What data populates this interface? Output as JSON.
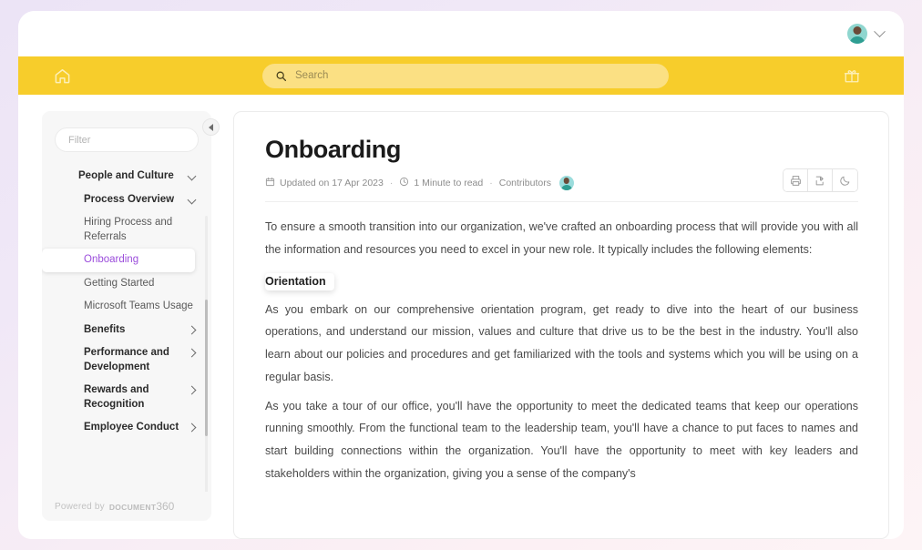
{
  "account": {
    "avatar_name": "user-avatar",
    "chevron": "chevron-down-icon"
  },
  "navbar": {
    "home_icon": "home-icon",
    "gift_icon": "gift-icon",
    "search": {
      "icon": "search-icon",
      "placeholder": "Search",
      "value": ""
    },
    "background_color": "#f7cd2b",
    "search_background_color": "#fbe083"
  },
  "sidebar": {
    "collapse_icon": "collapse-left-icon",
    "filter": {
      "placeholder": "Filter",
      "value": ""
    },
    "items": [
      {
        "label": "People and Culture",
        "level": 1,
        "chevron": "down",
        "selected": false
      },
      {
        "label": "Process Overview",
        "level": 2,
        "chevron": "down",
        "selected": false
      },
      {
        "label": "Hiring Process and Referrals",
        "level": 3,
        "chevron": "",
        "selected": false
      },
      {
        "label": "Onboarding",
        "level": 3,
        "chevron": "",
        "selected": true
      },
      {
        "label": "Getting Started",
        "level": 3,
        "chevron": "",
        "selected": false
      },
      {
        "label": "Microsoft Teams Usage",
        "level": 3,
        "chevron": "",
        "selected": false
      },
      {
        "label": "Benefits",
        "level": 2,
        "chevron": "right",
        "selected": false
      },
      {
        "label": "Performance and Development",
        "level": 2,
        "chevron": "right",
        "selected": false
      },
      {
        "label": "Rewards and Recognition",
        "level": 2,
        "chevron": "right",
        "selected": false
      },
      {
        "label": "Employee Conduct",
        "level": 2,
        "chevron": "right",
        "selected": false
      }
    ],
    "selected_color": "#9b4ddb",
    "footer": {
      "powered_by": "Powered by",
      "brand_prefix": "DOCUMENT",
      "brand_suffix": "360"
    }
  },
  "article": {
    "title": "Onboarding",
    "meta": {
      "calendar_icon": "calendar-icon",
      "updated": "Updated on 17 Apr 2023",
      "sep1": "·",
      "clock_icon": "clock-icon",
      "read_time": "1 Minute to read",
      "sep2": "·",
      "contributors_label": "Contributors",
      "contributor_avatar": "contributor-avatar"
    },
    "actions": [
      {
        "name": "print-icon",
        "title": "Print"
      },
      {
        "name": "share-icon",
        "title": "Share"
      },
      {
        "name": "dark-mode-moon-icon",
        "title": "Dark mode"
      }
    ],
    "paragraph_1": "To ensure a smooth transition into our organization, we've crafted an onboarding process that will provide you with all the information and resources you need to excel in your new role. It typically includes the following elements:",
    "heading_orientation": "Orientation",
    "paragraph_2": "As you embark on our comprehensive orientation program, get ready to dive into the heart of our business operations, and understand our mission, values and culture that drive us to be the best in the industry. You'll also learn about our policies and procedures and get familiarized with the tools and systems which you will be using on a regular basis.",
    "paragraph_3": "As you take a tour of our office, you'll have the opportunity to meet the dedicated teams that keep our operations running smoothly. From the functional team to the leadership team, you'll have a chance to put faces to names and start building connections within the organization. You'll have the opportunity to meet with key leaders and stakeholders within the organization, giving you a sense of the company's"
  }
}
